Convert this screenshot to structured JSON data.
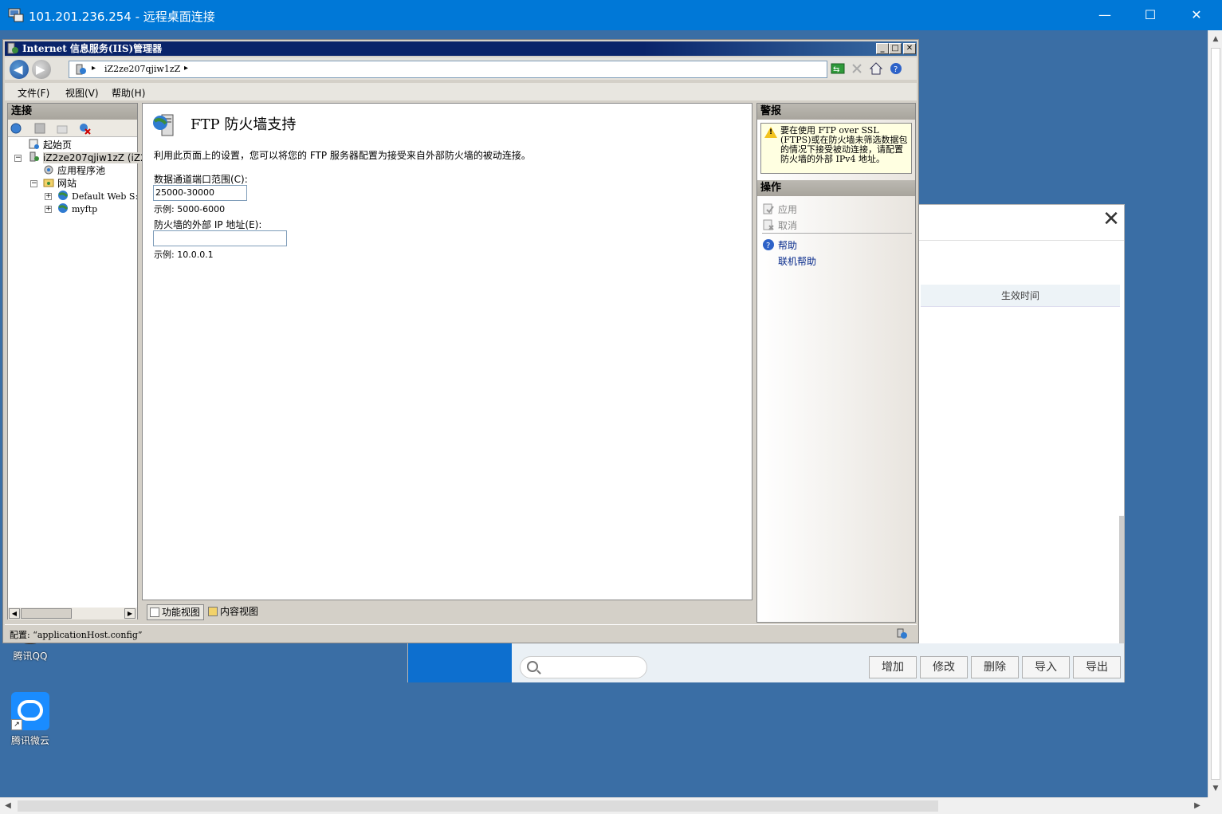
{
  "rdp": {
    "title": "101.201.236.254 - 远程桌面连接",
    "min_label": "—",
    "max_label": "☐",
    "close_label": "✕"
  },
  "desktop": {
    "icons": [
      {
        "label": "腾讯QQ"
      },
      {
        "label": "腾讯微云"
      }
    ]
  },
  "bg_dialog": {
    "close_label": "✕",
    "column_header": "生效时间",
    "buttons": [
      "增加",
      "修改",
      "删除",
      "导入",
      "导出"
    ]
  },
  "iis": {
    "title": "Internet 信息服务(IIS)管理器",
    "title_buttons": {
      "min": "_",
      "max": "□",
      "close": "✕"
    },
    "address": {
      "separator": "▸",
      "host": "iZ2ze207qjiw1zZ"
    },
    "menu": [
      "文件(F)",
      "视图(V)",
      "帮助(H)"
    ],
    "connections": {
      "header": "连接",
      "tree": [
        {
          "label": "起始页"
        },
        {
          "label": "iZ2ze207qjiw1zZ (iZ2"
        },
        {
          "label": "应用程序池"
        },
        {
          "label": "网站"
        },
        {
          "label": "Default Web S:"
        },
        {
          "label": "myftp"
        }
      ]
    },
    "page": {
      "title": "FTP 防火墙支持",
      "description": "利用此页面上的设置，您可以将您的 FTP 服务器配置为接受来自外部防火墙的被动连接。",
      "port_range_label": "数据通道端口范围(C):",
      "port_range_value": "25000-30000",
      "port_range_example": "示例: 5000-6000",
      "external_ip_label": "防火墙的外部 IP 地址(E):",
      "external_ip_value": "",
      "external_ip_example": "示例: 10.0.0.1"
    },
    "view_tabs": [
      "功能视图",
      "内容视图"
    ],
    "alerts": {
      "header": "警报",
      "text": "要在使用 FTP over SSL (FTPS)或在防火墙未筛选数据包的情况下接受被动连接，请配置防火墙的外部 IPv4 地址。"
    },
    "actions": {
      "header": "操作",
      "apply": "应用",
      "cancel": "取消",
      "help": "帮助",
      "online_help": "联机帮助"
    },
    "status": "配置: “applicationHost.config”"
  }
}
